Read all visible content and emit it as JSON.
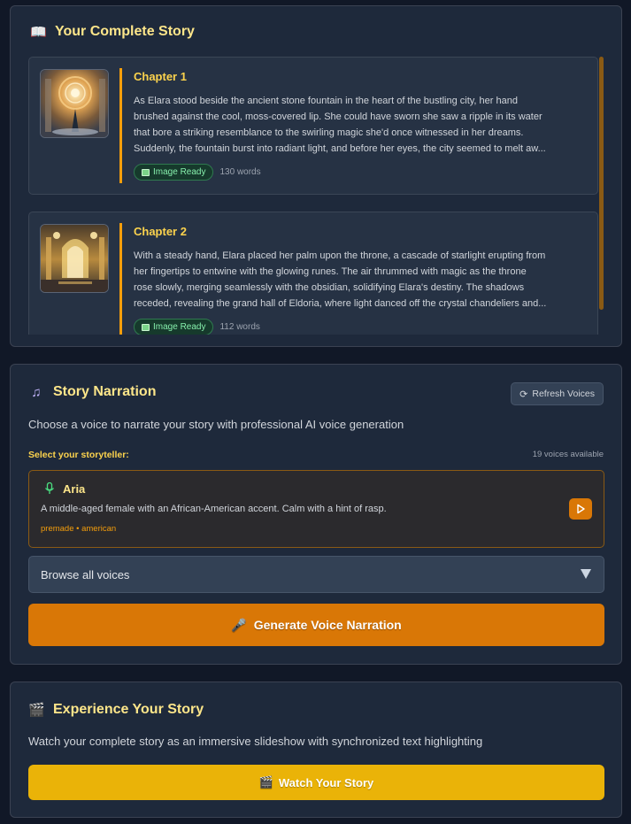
{
  "story": {
    "title": "Your Complete Story",
    "icon": "book-icon",
    "chapters": [
      {
        "title": "Chapter 1",
        "lines": [
          "As Elara stood beside the ancient stone fountain in the heart of the bustling city, her hand",
          "brushed against the cool, moss-covered lip. She could have sworn she saw a ripple in its water",
          "that bore a striking resemblance to the swirling magic she'd once witnessed in her dreams.",
          "Suddenly, the fountain burst into radiant light, and before her eyes, the city seemed to melt aw..."
        ],
        "status": "Image Ready",
        "words": "130 words"
      },
      {
        "title": "Chapter 2",
        "lines": [
          "With a steady hand, Elara placed her palm upon the throne, a cascade of starlight erupting from",
          "her fingertips to entwine with the glowing runes. The air thrummed with magic as the throne",
          "rose slowly, merging seamlessly with the obsidian, solidifying Elara's destiny. The shadows",
          "receded, revealing the grand hall of Eldoria, where light danced off the crystal chandeliers and..."
        ],
        "status": "Image Ready",
        "words": "112 words"
      }
    ]
  },
  "narration": {
    "title": "Story Narration",
    "icon": "music-note-icon",
    "refresh_label": "Refresh Voices",
    "description": "Choose a voice to narrate your story with professional AI voice generation",
    "select_label": "Select your storyteller:",
    "voices_count": "19 voices available",
    "selected_voice": {
      "name": "Aria",
      "description": "A middle-aged female with an African-American accent. Calm with a hint of rasp.",
      "tags": "premade • american"
    },
    "browse_label": "Browse all voices",
    "generate_label": "Generate Voice Narration"
  },
  "experience": {
    "title": "Experience Your Story",
    "icon": "clapperboard-icon",
    "description": "Watch your complete story as an immersive slideshow with synchronized text highlighting",
    "watch_label": "Watch Your Story"
  },
  "colors": {
    "accent_orange": "#d97706",
    "accent_yellow": "#eab308",
    "title_gold": "#fde68a",
    "success_green": "#86efac"
  }
}
